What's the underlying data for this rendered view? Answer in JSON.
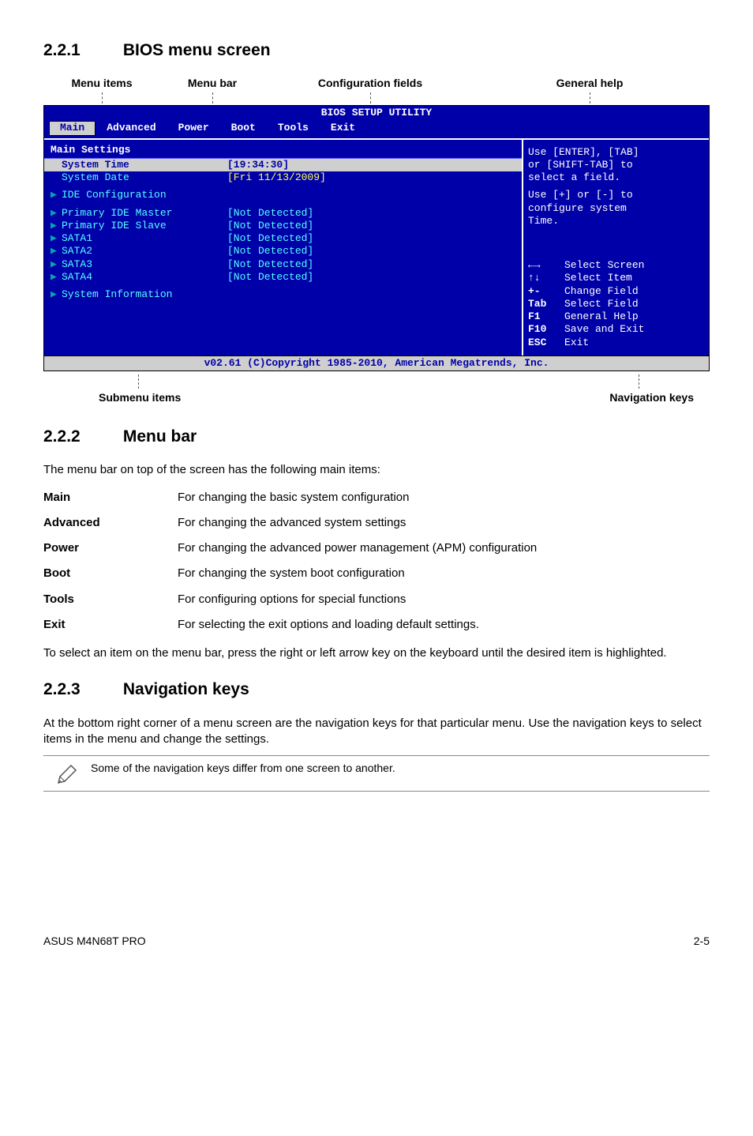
{
  "s221": {
    "num": "2.2.1",
    "title": "BIOS menu screen"
  },
  "anno": {
    "menu_items": "Menu items",
    "menu_bar": "Menu bar",
    "config_fields": "Configuration fields",
    "general_help": "General help",
    "submenu_items": "Submenu items",
    "nav_keys": "Navigation keys"
  },
  "bios": {
    "title": "BIOS SETUP UTILITY",
    "menus": {
      "main": "Main",
      "advanced": "Advanced",
      "power": "Power",
      "boot": "Boot",
      "tools": "Tools",
      "exit": "Exit"
    },
    "subhead": "Main Settings",
    "rows": {
      "system_time_l": "System Time",
      "system_time_v": "[19:34:30]",
      "system_date_l": "System Date",
      "system_date_v": "[Fri 11/13/2009]",
      "ide_cfg": "IDE Configuration",
      "pim": "Primary IDE Master",
      "pim_v": "[Not Detected]",
      "pis": "Primary IDE Slave",
      "pis_v": "[Not Detected]",
      "s1": "SATA1",
      "s1_v": "[Not Detected]",
      "s2": "SATA2",
      "s2_v": "[Not Detected]",
      "s3": "SATA3",
      "s3_v": "[Not Detected]",
      "s4": "SATA4",
      "s4_v": "[Not Detected]",
      "sysinfo": "System Information"
    },
    "help": {
      "l1": "Use [ENTER], [TAB]",
      "l2": "or [SHIFT-TAB] to",
      "l3": "select a field.",
      "l4": "Use [+] or [-] to",
      "l5": "configure system",
      "l6": "Time."
    },
    "keys": {
      "k1": "Select Screen",
      "k2": "Select Item",
      "k3l": "+-",
      "k3": "Change Field",
      "k4l": "Tab",
      "k4": "Select Field",
      "k5l": "F1",
      "k5": "General Help",
      "k6l": "F10",
      "k6": "Save and Exit",
      "k7l": "ESC",
      "k7": "Exit"
    },
    "footer": "v02.61 (C)Copyright 1985-2010, American Megatrends, Inc."
  },
  "s222": {
    "num": "2.2.2",
    "title": "Menu bar",
    "lead": "The menu bar on top of the screen has the following main items:",
    "defs": [
      {
        "t": "Main",
        "d": "For changing the basic system configuration"
      },
      {
        "t": "Advanced",
        "d": "For changing the advanced system settings"
      },
      {
        "t": "Power",
        "d": "For changing the advanced power management (APM) configuration"
      },
      {
        "t": "Boot",
        "d": "For changing the system boot configuration"
      },
      {
        "t": "Tools",
        "d": "For configuring options for special functions"
      },
      {
        "t": "Exit",
        "d": "For selecting the exit options and loading default settings."
      }
    ],
    "trail": "To select an item on the menu bar, press the right or left arrow key on the keyboard until the desired item is highlighted."
  },
  "s223": {
    "num": "2.2.3",
    "title": "Navigation keys",
    "para": "At the bottom right corner of a menu screen are the navigation keys for that particular menu. Use the navigation keys to select items in the menu and change the settings.",
    "note": "Some of the navigation keys differ from one screen to another."
  },
  "footer": {
    "left": "ASUS M4N68T PRO",
    "right": "2-5"
  }
}
